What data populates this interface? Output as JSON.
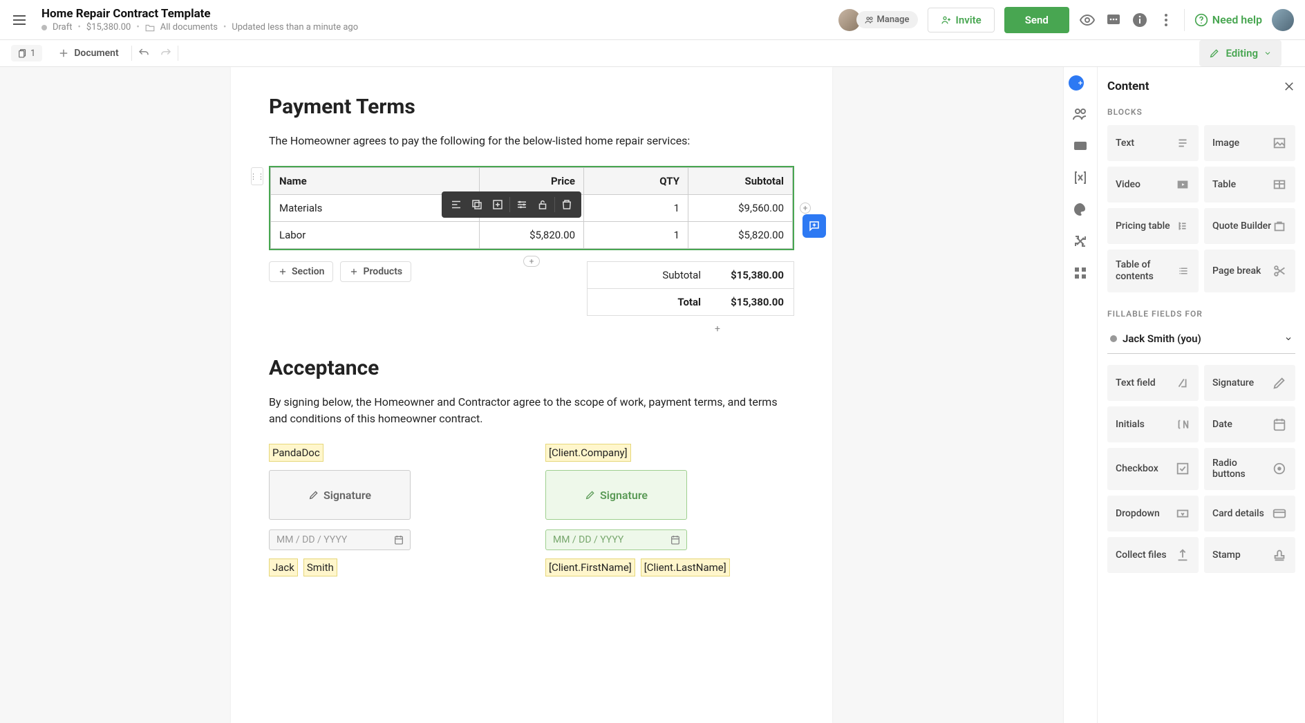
{
  "header": {
    "title": "Home Repair Contract Template",
    "status": "Draft",
    "amount": "$15,380.00",
    "location": "All documents",
    "updated": "Updated less than a minute ago",
    "manage": "Manage",
    "invite": "Invite",
    "send": "Send",
    "help": "Need help"
  },
  "toolbar": {
    "page": "1",
    "document_btn": "Document",
    "editing": "Editing"
  },
  "doc": {
    "h1": "Payment Terms",
    "intro": "The Homeowner agrees to pay the following for the below-listed home repair services:",
    "table": {
      "cols": [
        "Name",
        "Price",
        "QTY",
        "Subtotal"
      ],
      "rows": [
        {
          "name": "Materials",
          "price": "$9,560.00",
          "qty": "1",
          "sub": "$9,560.00"
        },
        {
          "name": "Labor",
          "price": "$5,820.00",
          "qty": "1",
          "sub": "$5,820.00"
        }
      ]
    },
    "add_section": "Section",
    "add_products": "Products",
    "totals": {
      "subtotal_label": "Subtotal",
      "subtotal_value": "$15,380.00",
      "total_label": "Total",
      "total_value": "$15,380.00"
    },
    "h2": "Acceptance",
    "accept_txt": "By signing below, the Homeowner and Contractor agree to the scope of work, payment terms, and terms and conditions of this homeowner contract.",
    "left": {
      "company": "PandaDoc",
      "sig": "Signature",
      "date_ph": "MM / DD / YYYY",
      "first": "Jack",
      "last": "Smith"
    },
    "right": {
      "company": "[Client.Company]",
      "sig": "Signature",
      "date_ph": "MM / DD / YYYY",
      "first": "[Client.FirstName]",
      "last": "[Client.LastName]"
    }
  },
  "panel": {
    "title": "Content",
    "blocks_label": "BLOCKS",
    "blocks": {
      "text": "Text",
      "image": "Image",
      "video": "Video",
      "table": "Table",
      "pricing": "Pricing table",
      "quote": "Quote Builder",
      "toc": "Table of contents",
      "pagebreak": "Page break"
    },
    "ff_label": "FILLABLE FIELDS FOR",
    "ff_person": "Jack Smith (you)",
    "fields": {
      "textfield": "Text field",
      "signature": "Signature",
      "initials": "Initials",
      "date": "Date",
      "checkbox": "Checkbox",
      "radio": "Radio buttons",
      "dropdown": "Dropdown",
      "card": "Card details",
      "collect": "Collect files",
      "stamp": "Stamp"
    }
  }
}
